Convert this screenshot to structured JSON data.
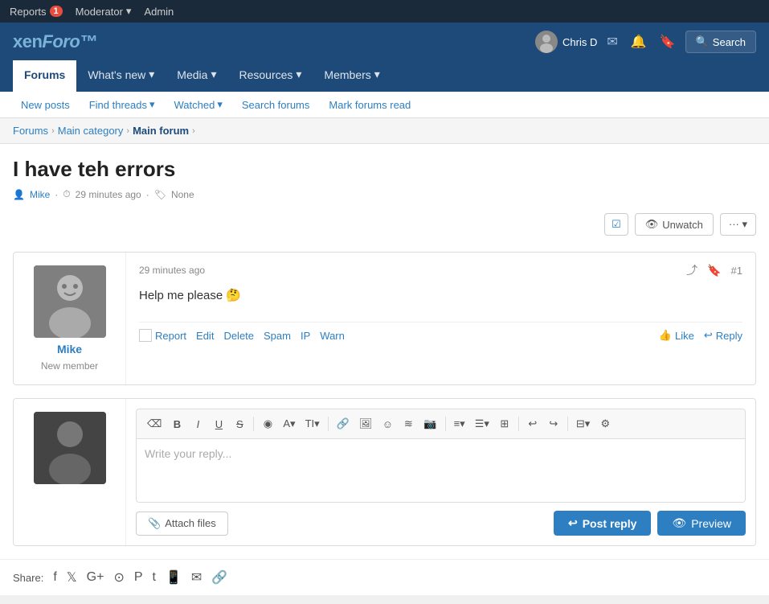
{
  "admin_bar": {
    "reports_label": "Reports",
    "reports_count": "1",
    "moderator_label": "Moderator",
    "admin_label": "Admin"
  },
  "header": {
    "logo_xen": "xen",
    "logo_foro": "Foro™",
    "user_name": "Chris D",
    "search_label": "Search"
  },
  "main_nav": {
    "forums": "Forums",
    "whats_new": "What's new",
    "media": "Media",
    "resources": "Resources",
    "members": "Members"
  },
  "secondary_nav": {
    "new_posts": "New posts",
    "find_threads": "Find threads",
    "watched": "Watched",
    "search_forums": "Search forums",
    "mark_forums_read": "Mark forums read"
  },
  "breadcrumb": {
    "forums": "Forums",
    "main_category": "Main category",
    "main_forum": "Main forum"
  },
  "thread": {
    "title": "I have teh errors",
    "author": "Mike",
    "time": "29 minutes ago",
    "tags": "None"
  },
  "thread_actions": {
    "unwatch": "Unwatch"
  },
  "post": {
    "time": "29 minutes ago",
    "number": "#1",
    "body": "Help me please 🤔",
    "author": "Mike",
    "author_title": "New member",
    "report": "Report",
    "edit": "Edit",
    "delete": "Delete",
    "spam": "Spam",
    "ip": "IP",
    "warn": "Warn",
    "like": "Like",
    "reply": "Reply"
  },
  "editor": {
    "placeholder": "Write your reply...",
    "attach_files": "Attach files",
    "post_reply": "Post reply",
    "preview": "Preview"
  },
  "share": {
    "label": "Share:"
  },
  "toolbar_buttons": [
    {
      "id": "eraser",
      "label": "⌫"
    },
    {
      "id": "bold",
      "label": "B"
    },
    {
      "id": "italic",
      "label": "I"
    },
    {
      "id": "underline",
      "label": "U"
    },
    {
      "id": "strikethrough",
      "label": "S"
    },
    {
      "id": "color",
      "label": "◉"
    },
    {
      "id": "font-size",
      "label": "A▾"
    },
    {
      "id": "text-format",
      "label": "TI▾"
    },
    {
      "id": "link",
      "label": "🔗"
    },
    {
      "id": "image",
      "label": "🖼"
    },
    {
      "id": "emoji",
      "label": "☺"
    },
    {
      "id": "media",
      "label": "≋"
    },
    {
      "id": "camera",
      "label": "📷"
    },
    {
      "id": "align",
      "label": "≡▾"
    },
    {
      "id": "list",
      "label": "☰▾"
    },
    {
      "id": "table",
      "label": "⊞"
    },
    {
      "id": "undo",
      "label": "↩"
    },
    {
      "id": "redo",
      "label": "↪"
    },
    {
      "id": "template",
      "label": "⊟▾"
    },
    {
      "id": "settings",
      "label": "⚙"
    }
  ]
}
